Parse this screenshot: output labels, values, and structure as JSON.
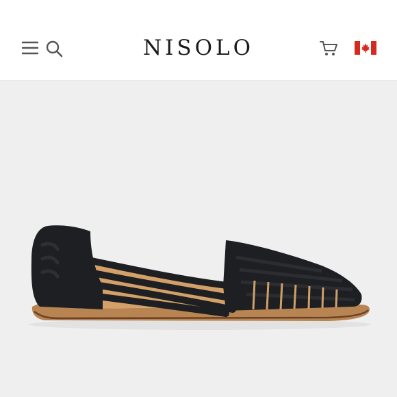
{
  "header": {
    "brand": "NISOLO",
    "icons": [
      "hamburger-menu-icon",
      "search-icon",
      "cart-icon",
      "canada-flag-icon"
    ]
  },
  "colors": {
    "header_bg": "#ffffff",
    "hero_bg": "#efefef",
    "icon_color": "#555555",
    "brand_color": "#1a1a1a",
    "flag_red": "#d52b1e",
    "shoe_leather": "#1e1f22",
    "shoe_sole": "#b88552"
  }
}
